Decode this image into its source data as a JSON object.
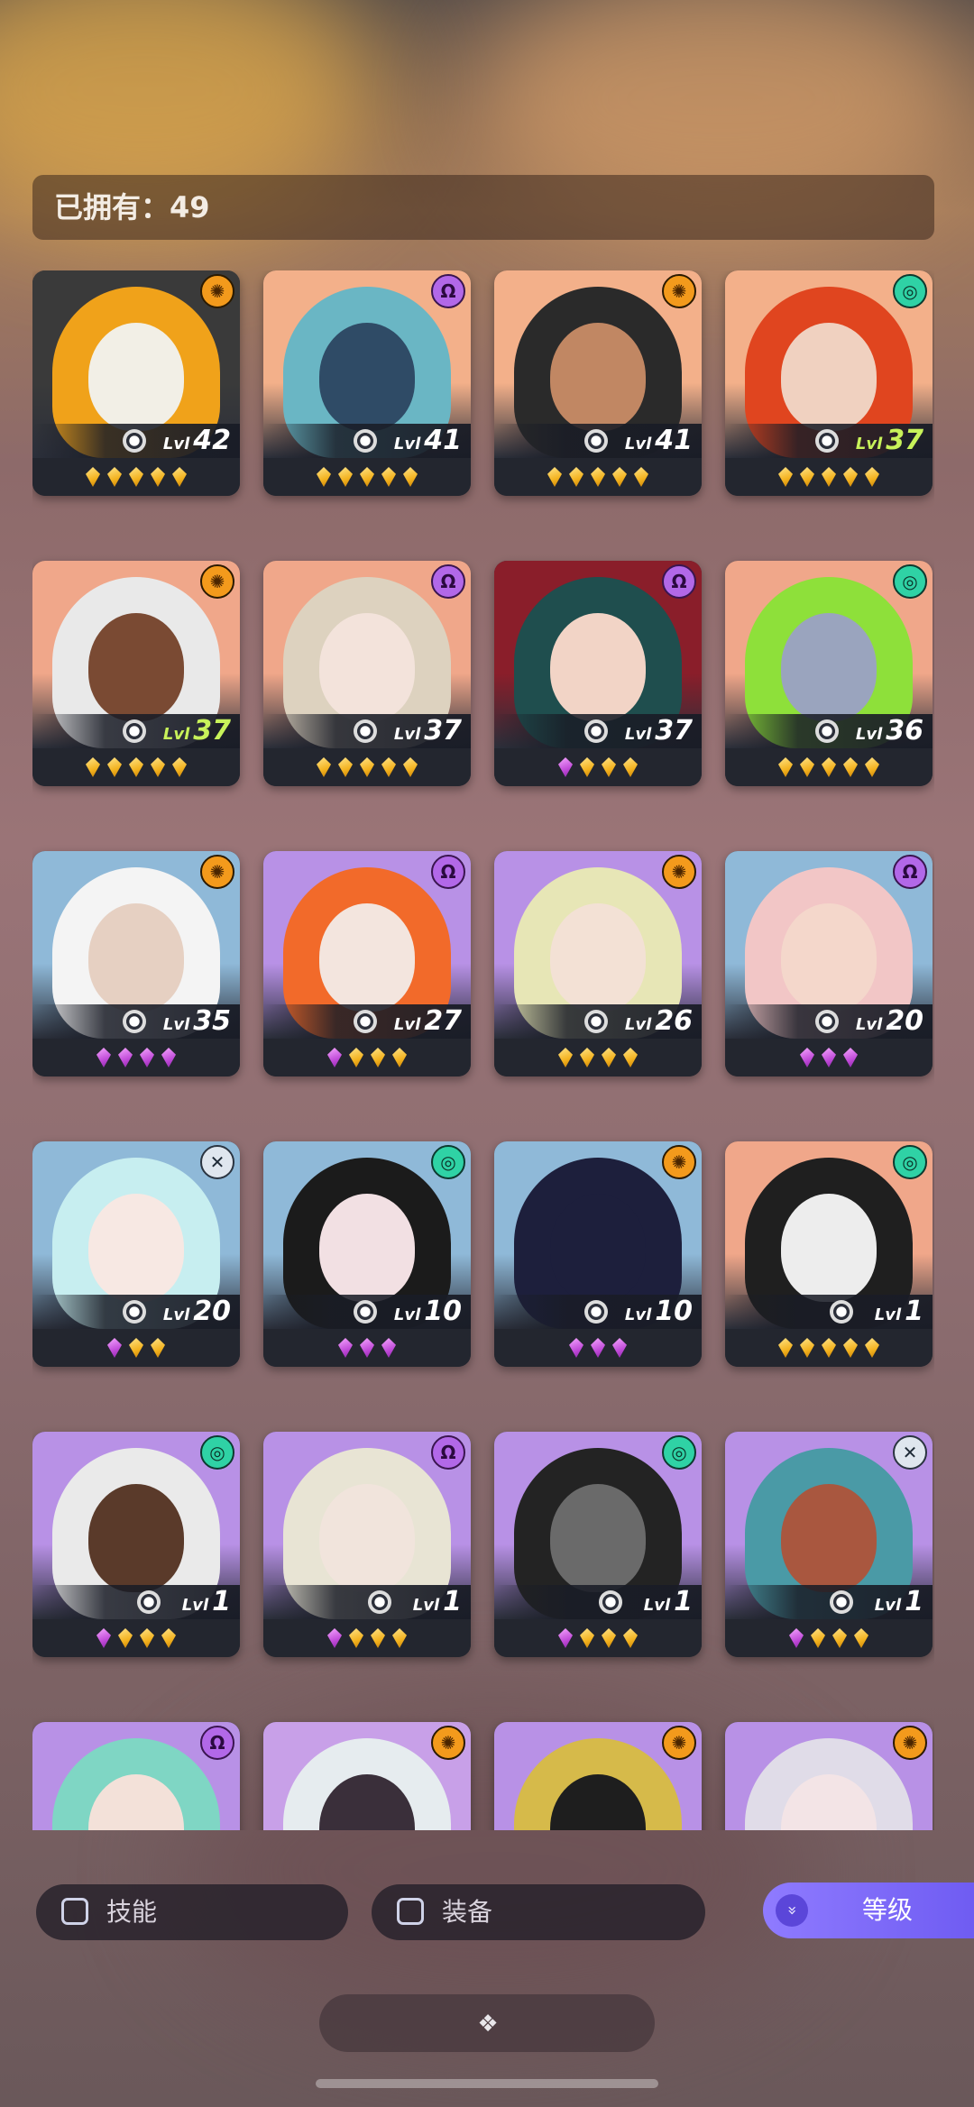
{
  "header": {
    "owned_label": "已拥有：49"
  },
  "heroes": [
    {
      "level": "42",
      "lvl_label": "Lvl",
      "green": false,
      "cls": "orange",
      "cls_icon": "✺",
      "stars": [
        "gold",
        "gold",
        "gold",
        "gold",
        "gold"
      ],
      "bg": "#3a3a3a",
      "hair": "#f0a21a",
      "skin": "#f2efe6"
    },
    {
      "level": "41",
      "lvl_label": "Lvl",
      "green": false,
      "cls": "purple",
      "cls_icon": "Ω",
      "stars": [
        "gold",
        "gold",
        "gold",
        "gold",
        "gold"
      ],
      "bg": "#f3b08a",
      "hair": "#6ab6c4",
      "skin": "#2f4b66"
    },
    {
      "level": "41",
      "lvl_label": "Lvl",
      "green": false,
      "cls": "orange",
      "cls_icon": "✺",
      "stars": [
        "gold",
        "gold",
        "gold",
        "gold",
        "gold"
      ],
      "bg": "#f3b08a",
      "hair": "#2a2a2a",
      "skin": "#c18763"
    },
    {
      "level": "37",
      "lvl_label": "Lvl",
      "green": true,
      "cls": "teal",
      "cls_icon": "◎",
      "stars": [
        "gold",
        "gold",
        "gold",
        "gold",
        "gold"
      ],
      "bg": "#f3b08a",
      "hair": "#e0451f",
      "skin": "#f0d1c0"
    },
    {
      "level": "37",
      "lvl_label": "Lvl",
      "green": true,
      "cls": "orange",
      "cls_icon": "✺",
      "stars": [
        "gold",
        "gold",
        "gold",
        "gold",
        "gold"
      ],
      "bg": "#f0a78a",
      "hair": "#e9e9e9",
      "skin": "#7a4a33"
    },
    {
      "level": "37",
      "lvl_label": "Lvl",
      "green": false,
      "cls": "purple",
      "cls_icon": "Ω",
      "stars": [
        "gold",
        "gold",
        "gold",
        "gold",
        "gold"
      ],
      "bg": "#f0a78a",
      "hair": "#ddd2bf",
      "skin": "#f3e3db"
    },
    {
      "level": "37",
      "lvl_label": "Lvl",
      "green": false,
      "cls": "purple",
      "cls_icon": "Ω",
      "stars": [
        "purple",
        "gold",
        "gold",
        "gold"
      ],
      "bg": "#8a1e2a",
      "hair": "#1f4e4e",
      "skin": "#f2d4c6"
    },
    {
      "level": "36",
      "lvl_label": "Lvl",
      "green": false,
      "cls": "teal",
      "cls_icon": "◎",
      "stars": [
        "gold",
        "gold",
        "gold",
        "gold",
        "gold"
      ],
      "bg": "#f0a78a",
      "hair": "#8ee03a",
      "skin": "#9aa4be"
    },
    {
      "level": "35",
      "lvl_label": "Lvl",
      "green": false,
      "cls": "orange",
      "cls_icon": "✺",
      "stars": [
        "purple",
        "purple",
        "purple",
        "purple"
      ],
      "bg": "#8fb9d8",
      "hair": "#f4f4f4",
      "skin": "#e6d0c2"
    },
    {
      "level": "27",
      "lvl_label": "Lvl",
      "green": false,
      "cls": "purple",
      "cls_icon": "Ω",
      "stars": [
        "purple",
        "gold",
        "gold",
        "gold"
      ],
      "bg": "#b891e6",
      "hair": "#f26a2a",
      "skin": "#f3e5de"
    },
    {
      "level": "26",
      "lvl_label": "Lvl",
      "green": false,
      "cls": "orange",
      "cls_icon": "✺",
      "stars": [
        "gold",
        "gold",
        "gold",
        "gold"
      ],
      "bg": "#b891e6",
      "hair": "#e7e6b6",
      "skin": "#f3e1d5"
    },
    {
      "level": "20",
      "lvl_label": "Lvl",
      "green": false,
      "cls": "purple",
      "cls_icon": "Ω",
      "stars": [
        "purple",
        "purple",
        "purple"
      ],
      "bg": "#8fb9d8",
      "hair": "#f2c6c6",
      "skin": "#f4d7cb"
    },
    {
      "level": "20",
      "lvl_label": "Lvl",
      "green": false,
      "cls": "white",
      "cls_icon": "✕",
      "stars": [
        "purple",
        "gold",
        "gold"
      ],
      "bg": "#8fb9d8",
      "hair": "#c7eef0",
      "skin": "#f7e8e3"
    },
    {
      "level": "10",
      "lvl_label": "Lvl",
      "green": false,
      "cls": "teal",
      "cls_icon": "◎",
      "stars": [
        "purple",
        "purple",
        "purple"
      ],
      "bg": "#8fb9d8",
      "hair": "#1b1b1b",
      "skin": "#f2e0e3"
    },
    {
      "level": "10",
      "lvl_label": "Lvl",
      "green": false,
      "cls": "orange",
      "cls_icon": "✺",
      "stars": [
        "purple",
        "purple",
        "purple"
      ],
      "bg": "#8fb9d8",
      "hair": "#1d1f3c",
      "skin": "#1d1f3c"
    },
    {
      "level": "1",
      "lvl_label": "Lvl",
      "green": false,
      "cls": "teal",
      "cls_icon": "◎",
      "stars": [
        "gold",
        "gold",
        "gold",
        "gold",
        "gold"
      ],
      "bg": "#f0a78a",
      "hair": "#1f1f1f",
      "skin": "#ededed"
    },
    {
      "level": "1",
      "lvl_label": "Lvl",
      "green": false,
      "cls": "teal",
      "cls_icon": "◎",
      "stars": [
        "purple",
        "gold",
        "gold",
        "gold"
      ],
      "bg": "#b891e6",
      "hair": "#eaeaea",
      "skin": "#5a3a2a"
    },
    {
      "level": "1",
      "lvl_label": "Lvl",
      "green": false,
      "cls": "purple",
      "cls_icon": "Ω",
      "stars": [
        "purple",
        "gold",
        "gold",
        "gold"
      ],
      "bg": "#b891e6",
      "hair": "#e8e4d4",
      "skin": "#f1e4dc"
    },
    {
      "level": "1",
      "lvl_label": "Lvl",
      "green": false,
      "cls": "teal",
      "cls_icon": "◎",
      "stars": [
        "purple",
        "gold",
        "gold",
        "gold"
      ],
      "bg": "#b891e6",
      "hair": "#232323",
      "skin": "#6a6a6a"
    },
    {
      "level": "1",
      "lvl_label": "Lvl",
      "green": false,
      "cls": "white",
      "cls_icon": "✕",
      "stars": [
        "purple",
        "gold",
        "gold",
        "gold"
      ],
      "bg": "#b891e6",
      "hair": "#4a9aa6",
      "skin": "#a9573f"
    },
    {
      "level": "",
      "lvl_label": "",
      "green": false,
      "cls": "purple",
      "cls_icon": "Ω",
      "stars": [],
      "bg": "#b891e6",
      "hair": "#7fd6c4",
      "skin": "#f3e1d9"
    },
    {
      "level": "",
      "lvl_label": "",
      "green": false,
      "cls": "orange",
      "cls_icon": "✺",
      "stars": [],
      "bg": "#c8a0e8",
      "hair": "#e6ecef",
      "skin": "#3a2f3a"
    },
    {
      "level": "",
      "lvl_label": "",
      "green": false,
      "cls": "orange",
      "cls_icon": "✺",
      "stars": [],
      "bg": "#b891e6",
      "hair": "#d6ba4a",
      "skin": "#1e1e1e"
    },
    {
      "level": "",
      "lvl_label": "",
      "green": false,
      "cls": "orange",
      "cls_icon": "✺",
      "stars": [],
      "bg": "#b891e6",
      "hair": "#e0dce8",
      "skin": "#f3e4e6"
    }
  ],
  "bottom": {
    "skill_label": "技能",
    "equip_label": "装备",
    "sort_label": "等级",
    "sort_icon": "»"
  }
}
